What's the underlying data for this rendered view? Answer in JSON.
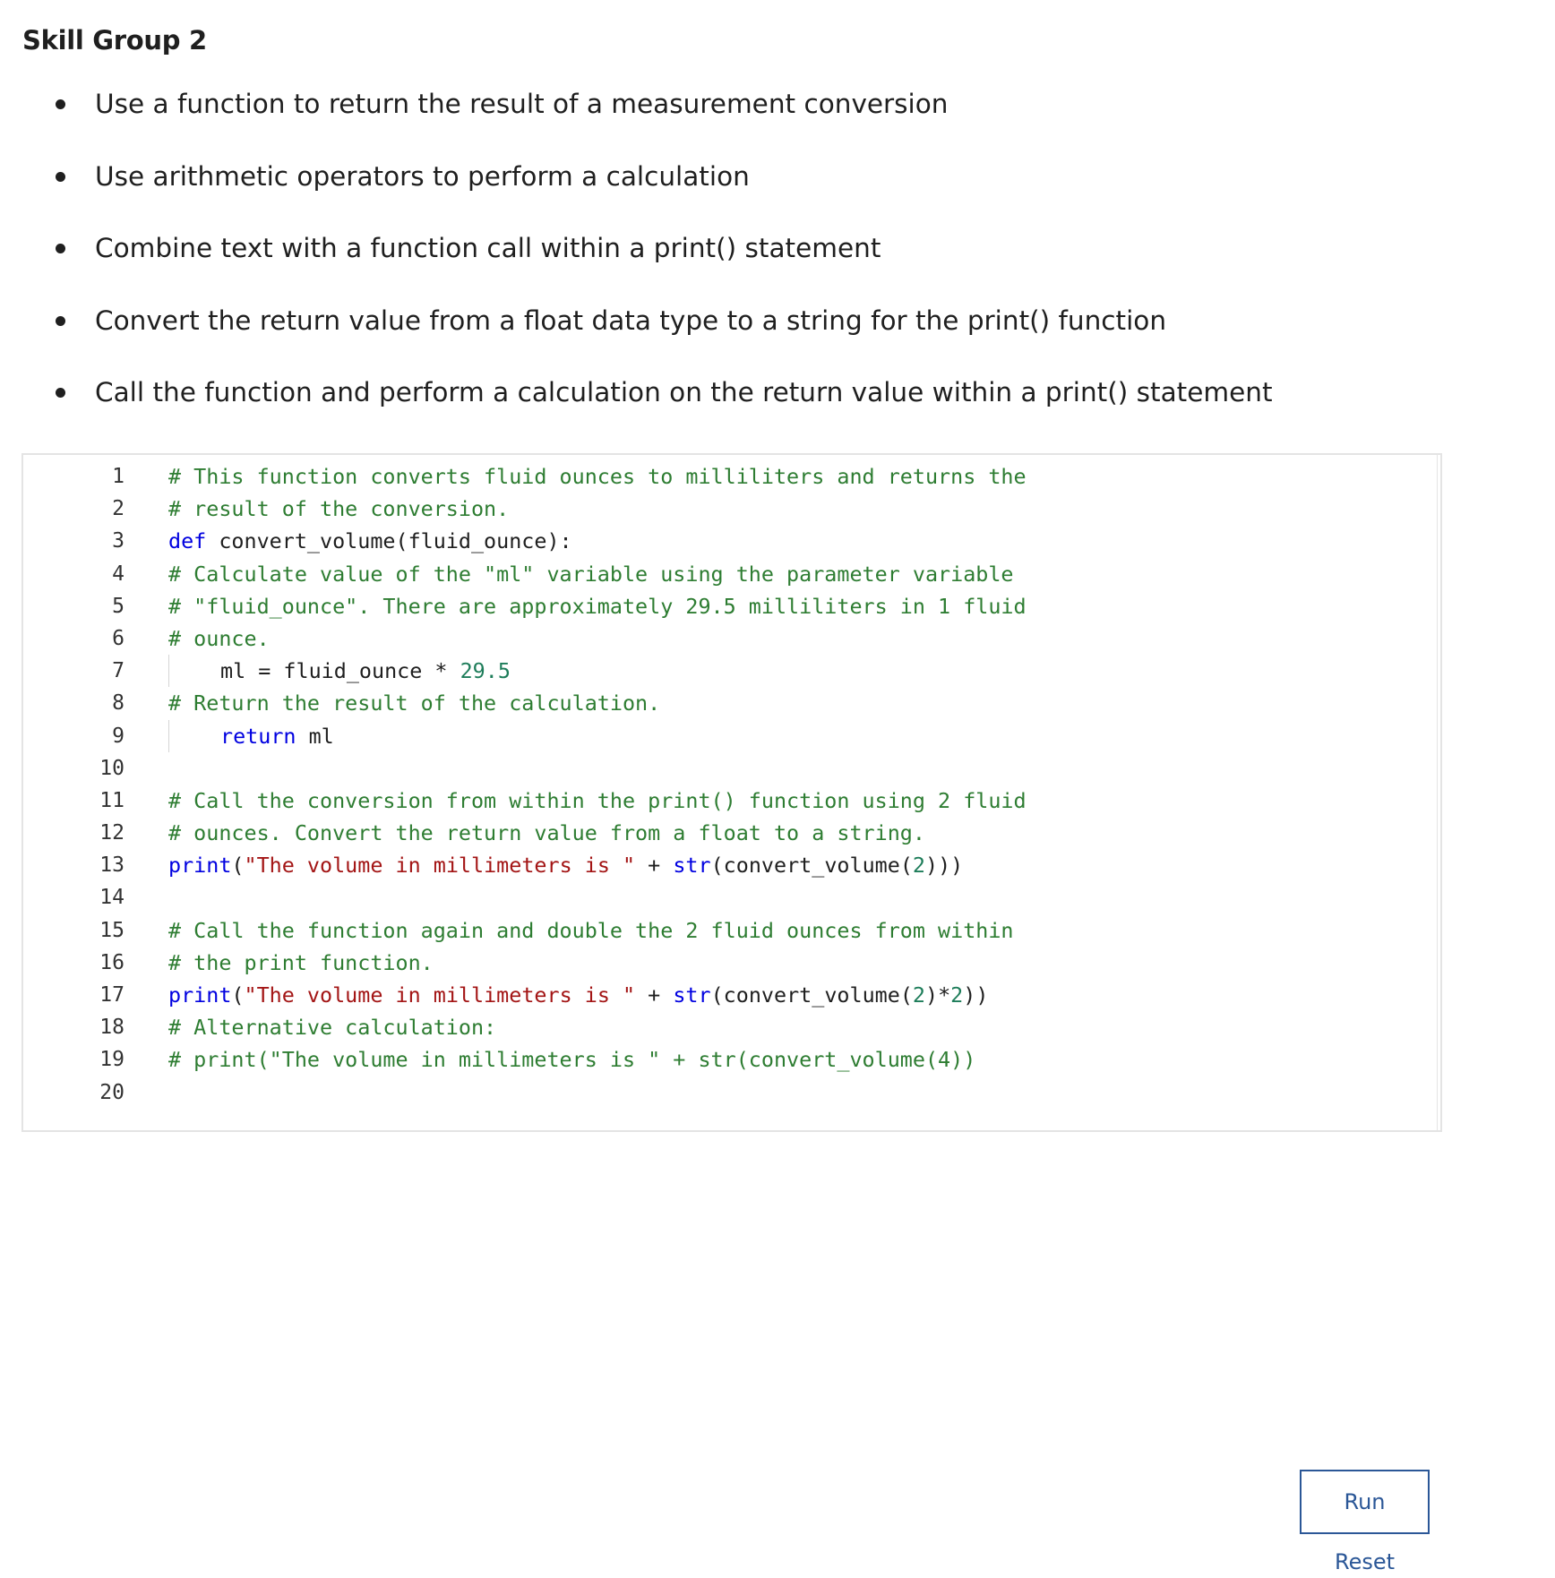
{
  "heading": "Skill Group 2",
  "skills": [
    "Use a function to return the result of a measurement conversion",
    "Use arithmetic operators to perform a calculation",
    "Combine text with a function call within a print() statement",
    "Convert the return value from a float data type to a string for the print() function",
    "Call the function and perform a calculation on the return value within a print() statement"
  ],
  "editor": {
    "line_numbers": [
      "1",
      "2",
      "3",
      "4",
      "5",
      "6",
      "7",
      "8",
      "9",
      "10",
      "11",
      "12",
      "13",
      "14",
      "15",
      "16",
      "17",
      "18",
      "19",
      "20"
    ],
    "lines": [
      {
        "indent": false,
        "tokens": [
          {
            "t": "comment",
            "v": "# This function converts fluid ounces to milliliters and returns the"
          }
        ]
      },
      {
        "indent": false,
        "tokens": [
          {
            "t": "comment",
            "v": "# result of the conversion."
          }
        ]
      },
      {
        "indent": false,
        "tokens": [
          {
            "t": "keyword",
            "v": "def"
          },
          {
            "t": "plain",
            "v": " convert_volume(fluid_ounce):"
          }
        ]
      },
      {
        "indent": false,
        "tokens": [
          {
            "t": "comment",
            "v": "# Calculate value of the \"ml\" variable using the parameter variable"
          }
        ]
      },
      {
        "indent": false,
        "tokens": [
          {
            "t": "comment",
            "v": "# \"fluid_ounce\". There are approximately 29.5 milliliters in 1 fluid"
          }
        ]
      },
      {
        "indent": false,
        "tokens": [
          {
            "t": "comment",
            "v": "# ounce."
          }
        ]
      },
      {
        "indent": true,
        "tokens": [
          {
            "t": "plain",
            "v": "ml = fluid_ounce * "
          },
          {
            "t": "number",
            "v": "29.5"
          }
        ]
      },
      {
        "indent": false,
        "tokens": [
          {
            "t": "comment",
            "v": "# Return the result of the calculation."
          }
        ]
      },
      {
        "indent": true,
        "tokens": [
          {
            "t": "keyword",
            "v": "return"
          },
          {
            "t": "plain",
            "v": " ml"
          }
        ]
      },
      {
        "indent": false,
        "tokens": []
      },
      {
        "indent": false,
        "tokens": [
          {
            "t": "comment",
            "v": "# Call the conversion from within the print() function using 2 fluid"
          }
        ]
      },
      {
        "indent": false,
        "tokens": [
          {
            "t": "comment",
            "v": "# ounces. Convert the return value from a float to a string."
          }
        ]
      },
      {
        "indent": false,
        "tokens": [
          {
            "t": "builtin",
            "v": "print"
          },
          {
            "t": "plain",
            "v": "("
          },
          {
            "t": "string",
            "v": "\"The volume in millimeters is \""
          },
          {
            "t": "plain",
            "v": " + "
          },
          {
            "t": "builtin",
            "v": "str"
          },
          {
            "t": "plain",
            "v": "(convert_volume("
          },
          {
            "t": "number",
            "v": "2"
          },
          {
            "t": "plain",
            "v": ")))"
          }
        ]
      },
      {
        "indent": false,
        "tokens": []
      },
      {
        "indent": false,
        "tokens": [
          {
            "t": "comment",
            "v": "# Call the function again and double the 2 fluid ounces from within"
          }
        ]
      },
      {
        "indent": false,
        "tokens": [
          {
            "t": "comment",
            "v": "# the print function."
          }
        ]
      },
      {
        "indent": false,
        "tokens": [
          {
            "t": "builtin",
            "v": "print"
          },
          {
            "t": "plain",
            "v": "("
          },
          {
            "t": "string",
            "v": "\"The volume in millimeters is \""
          },
          {
            "t": "plain",
            "v": " + "
          },
          {
            "t": "builtin",
            "v": "str"
          },
          {
            "t": "plain",
            "v": "(convert_volume("
          },
          {
            "t": "number",
            "v": "2"
          },
          {
            "t": "plain",
            "v": ")*"
          },
          {
            "t": "number",
            "v": "2"
          },
          {
            "t": "plain",
            "v": "))"
          }
        ]
      },
      {
        "indent": false,
        "tokens": [
          {
            "t": "comment",
            "v": "# Alternative calculation:"
          }
        ]
      },
      {
        "indent": false,
        "tokens": [
          {
            "t": "comment",
            "v": "# print(\"The volume in millimeters is \" + str(convert_volume(4))"
          }
        ]
      },
      {
        "indent": false,
        "tokens": []
      }
    ]
  },
  "buttons": {
    "run_label": "Run",
    "reset_label": "Reset"
  },
  "colors": {
    "comment": "#2e7d32",
    "keyword": "#0000e0",
    "string": "#a31515",
    "number": "#1e7d5a",
    "accent": "#2b5797"
  }
}
